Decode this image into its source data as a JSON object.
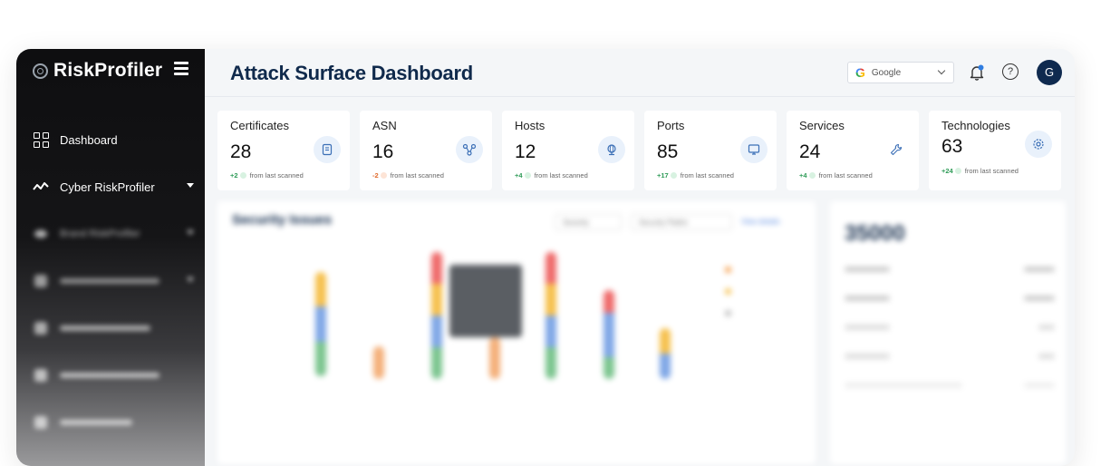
{
  "sidebar": {
    "brand": "RiskProfiler",
    "items": [
      {
        "label": "Dashboard",
        "icon": "dashboard-grid-icon"
      },
      {
        "label": "Cyber RiskProfiler",
        "icon": "pulse-icon",
        "has_caret": true
      },
      {
        "label": "Brand RiskProfiler",
        "icon": "eye-icon",
        "has_caret": true
      },
      {
        "label": "",
        "icon": "generic-icon",
        "has_caret": true
      },
      {
        "label": "",
        "icon": "generic-icon"
      },
      {
        "label": "",
        "icon": "generic-icon"
      },
      {
        "label": "",
        "icon": "generic-icon"
      }
    ]
  },
  "header": {
    "title": "Attack Surface Dashboard",
    "search_engine_select": "Google",
    "avatar_initial": "G"
  },
  "cards": [
    {
      "title": "Certificates",
      "value": "28",
      "delta": "+2",
      "delta_dir": "up",
      "suffix": "from last scanned",
      "icon": "certificate-icon"
    },
    {
      "title": "ASN",
      "value": "16",
      "delta": "-2",
      "delta_dir": "down",
      "suffix": "from last scanned",
      "icon": "network-nodes-icon"
    },
    {
      "title": "Hosts",
      "value": "12",
      "delta": "+4",
      "delta_dir": "up",
      "suffix": "from last scanned",
      "icon": "globe-icon"
    },
    {
      "title": "Ports",
      "value": "85",
      "delta": "+17",
      "delta_dir": "up",
      "suffix": "from last scanned",
      "icon": "monitor-icon"
    },
    {
      "title": "Services",
      "value": "24",
      "delta": "+4",
      "delta_dir": "up",
      "suffix": "from last scanned",
      "icon": "wrench-icon"
    },
    {
      "title": "Technologies",
      "value": "63",
      "delta": "+24",
      "delta_dir": "up",
      "suffix": "from last scanned",
      "icon": "gear-icon"
    }
  ],
  "security_issues": {
    "title": "Security Issues",
    "filter_severity": "Severity",
    "filter_platform": "Security Platfor",
    "view_link": "View details"
  },
  "totals": {
    "big_number": "35000"
  },
  "colors": {
    "navy": "#102a4c",
    "green": "#2e9b57",
    "orange": "#e06a2b",
    "icon_bg": "#e9f1fb"
  }
}
